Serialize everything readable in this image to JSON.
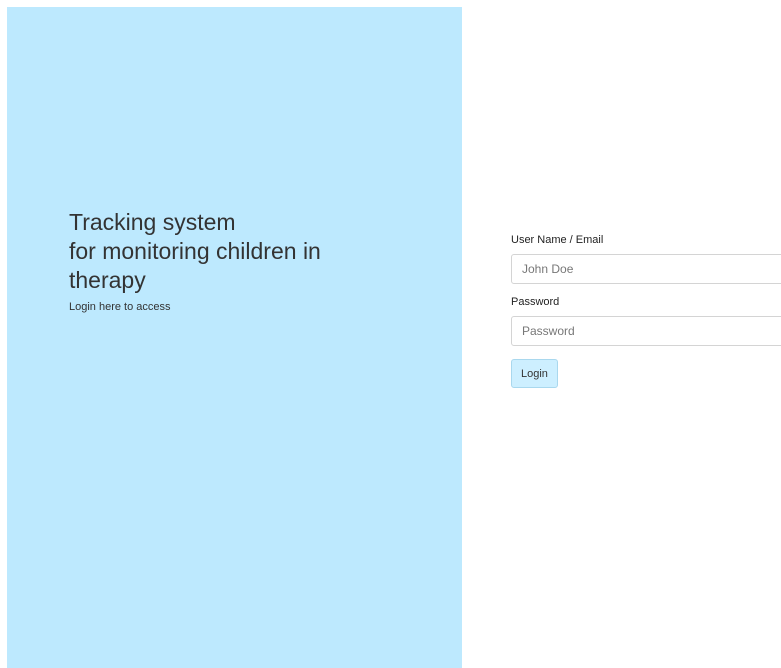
{
  "hero": {
    "title_line1": "Tracking system",
    "title_line2": "for monitoring children in",
    "title_line3": "therapy",
    "subtitle": "Login here to access"
  },
  "login": {
    "username_label": "User Name / Email",
    "username_placeholder": "John Doe",
    "username_value": "",
    "password_label": "Password",
    "password_placeholder": "Password",
    "password_value": "",
    "submit_label": "Login"
  },
  "colors": {
    "left_panel_bg": "#bde9fe",
    "button_bg": "#cdefff",
    "button_border": "#a9d8ee",
    "input_border": "#d4d4d4"
  }
}
